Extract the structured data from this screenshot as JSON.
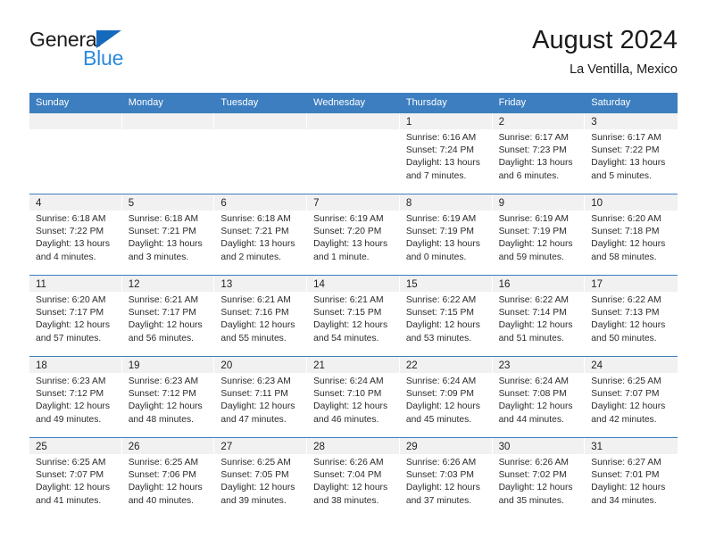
{
  "brand": {
    "name_part1": "General",
    "name_part2": "Blue",
    "triangle_color": "#1569bd",
    "blue_color": "#2b8ade"
  },
  "header": {
    "title": "August 2024",
    "subtitle": "La Ventilla, Mexico"
  },
  "theme": {
    "header_row_bg": "#3c7ebf",
    "day_band_bg": "#f1f1f1",
    "grid_line": "#3c7ebf"
  },
  "weekdays": [
    "Sunday",
    "Monday",
    "Tuesday",
    "Wednesday",
    "Thursday",
    "Friday",
    "Saturday"
  ],
  "weeks": [
    [
      {
        "day": "",
        "sunrise": "",
        "sunset": "",
        "daylight": ""
      },
      {
        "day": "",
        "sunrise": "",
        "sunset": "",
        "daylight": ""
      },
      {
        "day": "",
        "sunrise": "",
        "sunset": "",
        "daylight": ""
      },
      {
        "day": "",
        "sunrise": "",
        "sunset": "",
        "daylight": ""
      },
      {
        "day": "1",
        "sunrise": "Sunrise: 6:16 AM",
        "sunset": "Sunset: 7:24 PM",
        "daylight": "Daylight: 13 hours and 7 minutes."
      },
      {
        "day": "2",
        "sunrise": "Sunrise: 6:17 AM",
        "sunset": "Sunset: 7:23 PM",
        "daylight": "Daylight: 13 hours and 6 minutes."
      },
      {
        "day": "3",
        "sunrise": "Sunrise: 6:17 AM",
        "sunset": "Sunset: 7:22 PM",
        "daylight": "Daylight: 13 hours and 5 minutes."
      }
    ],
    [
      {
        "day": "4",
        "sunrise": "Sunrise: 6:18 AM",
        "sunset": "Sunset: 7:22 PM",
        "daylight": "Daylight: 13 hours and 4 minutes."
      },
      {
        "day": "5",
        "sunrise": "Sunrise: 6:18 AM",
        "sunset": "Sunset: 7:21 PM",
        "daylight": "Daylight: 13 hours and 3 minutes."
      },
      {
        "day": "6",
        "sunrise": "Sunrise: 6:18 AM",
        "sunset": "Sunset: 7:21 PM",
        "daylight": "Daylight: 13 hours and 2 minutes."
      },
      {
        "day": "7",
        "sunrise": "Sunrise: 6:19 AM",
        "sunset": "Sunset: 7:20 PM",
        "daylight": "Daylight: 13 hours and 1 minute."
      },
      {
        "day": "8",
        "sunrise": "Sunrise: 6:19 AM",
        "sunset": "Sunset: 7:19 PM",
        "daylight": "Daylight: 13 hours and 0 minutes."
      },
      {
        "day": "9",
        "sunrise": "Sunrise: 6:19 AM",
        "sunset": "Sunset: 7:19 PM",
        "daylight": "Daylight: 12 hours and 59 minutes."
      },
      {
        "day": "10",
        "sunrise": "Sunrise: 6:20 AM",
        "sunset": "Sunset: 7:18 PM",
        "daylight": "Daylight: 12 hours and 58 minutes."
      }
    ],
    [
      {
        "day": "11",
        "sunrise": "Sunrise: 6:20 AM",
        "sunset": "Sunset: 7:17 PM",
        "daylight": "Daylight: 12 hours and 57 minutes."
      },
      {
        "day": "12",
        "sunrise": "Sunrise: 6:21 AM",
        "sunset": "Sunset: 7:17 PM",
        "daylight": "Daylight: 12 hours and 56 minutes."
      },
      {
        "day": "13",
        "sunrise": "Sunrise: 6:21 AM",
        "sunset": "Sunset: 7:16 PM",
        "daylight": "Daylight: 12 hours and 55 minutes."
      },
      {
        "day": "14",
        "sunrise": "Sunrise: 6:21 AM",
        "sunset": "Sunset: 7:15 PM",
        "daylight": "Daylight: 12 hours and 54 minutes."
      },
      {
        "day": "15",
        "sunrise": "Sunrise: 6:22 AM",
        "sunset": "Sunset: 7:15 PM",
        "daylight": "Daylight: 12 hours and 53 minutes."
      },
      {
        "day": "16",
        "sunrise": "Sunrise: 6:22 AM",
        "sunset": "Sunset: 7:14 PM",
        "daylight": "Daylight: 12 hours and 51 minutes."
      },
      {
        "day": "17",
        "sunrise": "Sunrise: 6:22 AM",
        "sunset": "Sunset: 7:13 PM",
        "daylight": "Daylight: 12 hours and 50 minutes."
      }
    ],
    [
      {
        "day": "18",
        "sunrise": "Sunrise: 6:23 AM",
        "sunset": "Sunset: 7:12 PM",
        "daylight": "Daylight: 12 hours and 49 minutes."
      },
      {
        "day": "19",
        "sunrise": "Sunrise: 6:23 AM",
        "sunset": "Sunset: 7:12 PM",
        "daylight": "Daylight: 12 hours and 48 minutes."
      },
      {
        "day": "20",
        "sunrise": "Sunrise: 6:23 AM",
        "sunset": "Sunset: 7:11 PM",
        "daylight": "Daylight: 12 hours and 47 minutes."
      },
      {
        "day": "21",
        "sunrise": "Sunrise: 6:24 AM",
        "sunset": "Sunset: 7:10 PM",
        "daylight": "Daylight: 12 hours and 46 minutes."
      },
      {
        "day": "22",
        "sunrise": "Sunrise: 6:24 AM",
        "sunset": "Sunset: 7:09 PM",
        "daylight": "Daylight: 12 hours and 45 minutes."
      },
      {
        "day": "23",
        "sunrise": "Sunrise: 6:24 AM",
        "sunset": "Sunset: 7:08 PM",
        "daylight": "Daylight: 12 hours and 44 minutes."
      },
      {
        "day": "24",
        "sunrise": "Sunrise: 6:25 AM",
        "sunset": "Sunset: 7:07 PM",
        "daylight": "Daylight: 12 hours and 42 minutes."
      }
    ],
    [
      {
        "day": "25",
        "sunrise": "Sunrise: 6:25 AM",
        "sunset": "Sunset: 7:07 PM",
        "daylight": "Daylight: 12 hours and 41 minutes."
      },
      {
        "day": "26",
        "sunrise": "Sunrise: 6:25 AM",
        "sunset": "Sunset: 7:06 PM",
        "daylight": "Daylight: 12 hours and 40 minutes."
      },
      {
        "day": "27",
        "sunrise": "Sunrise: 6:25 AM",
        "sunset": "Sunset: 7:05 PM",
        "daylight": "Daylight: 12 hours and 39 minutes."
      },
      {
        "day": "28",
        "sunrise": "Sunrise: 6:26 AM",
        "sunset": "Sunset: 7:04 PM",
        "daylight": "Daylight: 12 hours and 38 minutes."
      },
      {
        "day": "29",
        "sunrise": "Sunrise: 6:26 AM",
        "sunset": "Sunset: 7:03 PM",
        "daylight": "Daylight: 12 hours and 37 minutes."
      },
      {
        "day": "30",
        "sunrise": "Sunrise: 6:26 AM",
        "sunset": "Sunset: 7:02 PM",
        "daylight": "Daylight: 12 hours and 35 minutes."
      },
      {
        "day": "31",
        "sunrise": "Sunrise: 6:27 AM",
        "sunset": "Sunset: 7:01 PM",
        "daylight": "Daylight: 12 hours and 34 minutes."
      }
    ]
  ]
}
